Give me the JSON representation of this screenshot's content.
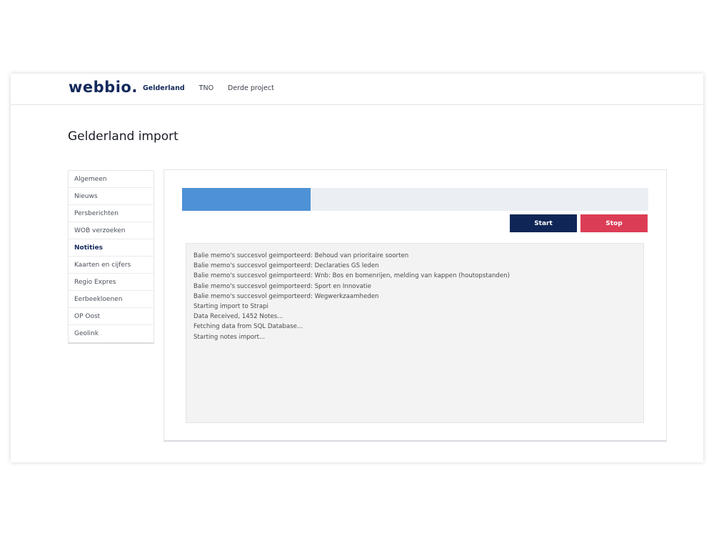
{
  "header": {
    "logo_text": "webbio.",
    "nav": [
      {
        "label": "Gelderland",
        "active": true
      },
      {
        "label": "TNO",
        "active": false
      },
      {
        "label": "Derde project",
        "active": false
      }
    ]
  },
  "page": {
    "title": "Gelderland import"
  },
  "sidebar": {
    "items": [
      {
        "label": "Algemeen"
      },
      {
        "label": "Nieuws"
      },
      {
        "label": "Persberichten"
      },
      {
        "label": "WOB verzoeken"
      },
      {
        "label": "Notities",
        "active": true
      },
      {
        "label": "Kaarten en cijfers"
      },
      {
        "label": "Regio Expres"
      },
      {
        "label": "Eerbeekloenen"
      },
      {
        "label": "OP Oost"
      },
      {
        "label": "Geolink"
      }
    ]
  },
  "import_panel": {
    "progress_fraction": 0.276,
    "start_label": "Start",
    "stop_label": "Stop",
    "log_lines": [
      "Balie memo's succesvol geimporteerd: Behoud van prioritaire soorten",
      "Balie memo's succesvol geimporteerd: Declaraties GS leden",
      "Balie memo's succesvol geimporteerd: Wnb: Bos en bomenrijen, melding van kappen (houtopstanden)",
      "Balie memo's succesvol geimporteerd: Sport en Innovatie",
      "Balie memo's succesvol geimporteerd: Wegwerkzaamheden",
      "Starting import to Strapi",
      "Data Received, 1452 Notes...",
      "Fetching data from SQL Database...",
      "Starting notes import..."
    ]
  },
  "colors": {
    "brand": "#13285b",
    "progress": "#4e91d6",
    "start_button": "#0f2656",
    "stop_button": "#dc3d56"
  }
}
